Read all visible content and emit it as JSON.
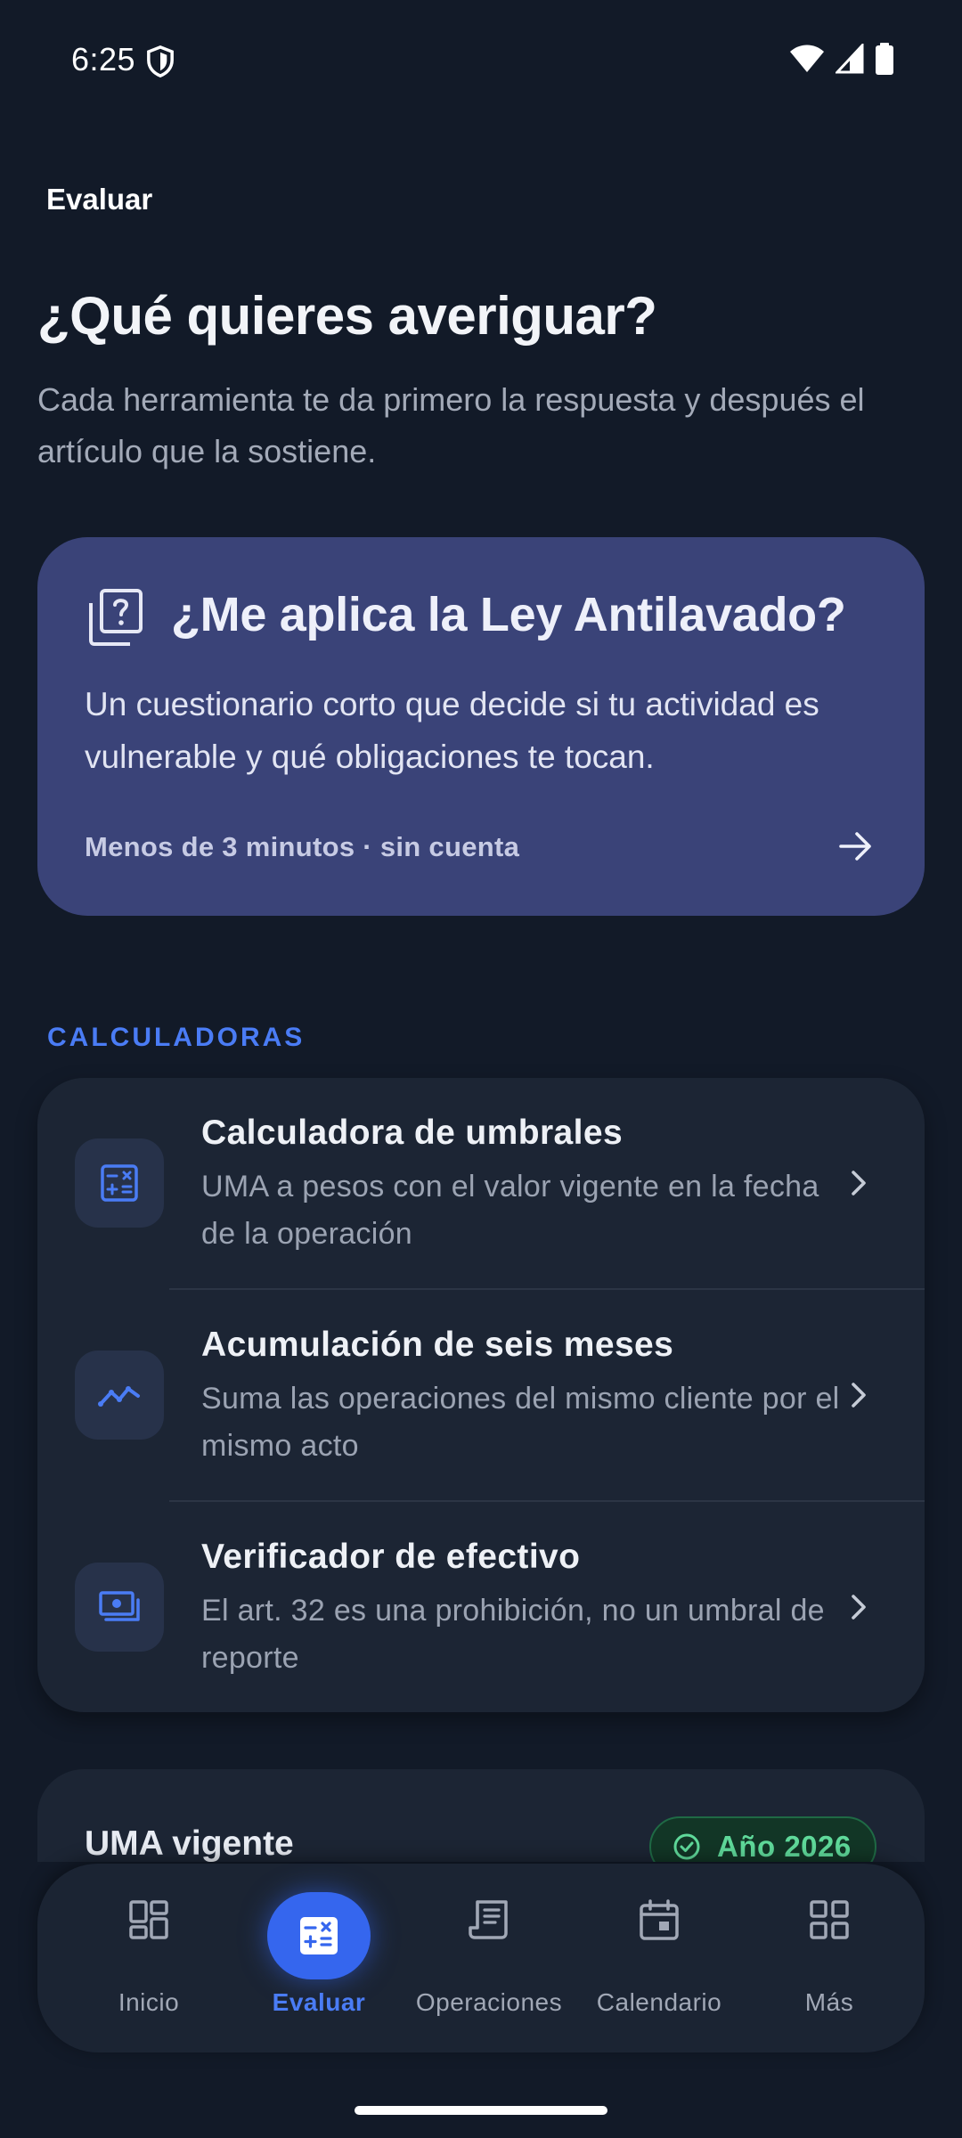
{
  "status_bar": {
    "time": "6:25"
  },
  "app_bar": {
    "title": "Evaluar"
  },
  "header": {
    "headline": "¿Qué quieres averiguar?",
    "subhead": "Cada herramienta te da primero la respuesta y después el artículo que la sostiene."
  },
  "hero": {
    "title": "¿Me aplica la Ley Antilavado?",
    "description": "Un cuestionario corto que decide si tu actividad es vulnerable y qué obligaciones te tocan.",
    "footer": "Menos de 3 minutos · sin cuenta",
    "icon": "quiz-icon",
    "action_icon": "arrow-right-icon"
  },
  "calculators": {
    "section_label": "CALCULADORAS",
    "items": [
      {
        "title": "Calculadora de umbrales",
        "description": "UMA a pesos con el valor vigente en la fecha de la operación",
        "icon": "calculator-icon"
      },
      {
        "title": "Acumulación de seis meses",
        "description": "Suma las operaciones del mismo cliente por el mismo acto",
        "icon": "trend-icon"
      },
      {
        "title": "Verificador de efectivo",
        "description": "El art. 32 es una prohibición, no un umbral de reporte",
        "icon": "cash-icon"
      }
    ]
  },
  "uma": {
    "title": "UMA vigente",
    "badge": "Año 2026"
  },
  "bottom_nav": {
    "items": [
      {
        "label": "Inicio",
        "icon": "dashboard-icon"
      },
      {
        "label": "Evaluar",
        "icon": "calculator-icon",
        "active": true
      },
      {
        "label": "Operaciones",
        "icon": "receipt-icon"
      },
      {
        "label": "Calendario",
        "icon": "calendar-icon"
      },
      {
        "label": "Más",
        "icon": "grid-icon"
      }
    ]
  },
  "colors": {
    "background": "#121a28",
    "hero_card": "#3a4378",
    "accent": "#4a7cf5",
    "active_pill": "#3566ee",
    "badge_green": "#5fd99a"
  }
}
